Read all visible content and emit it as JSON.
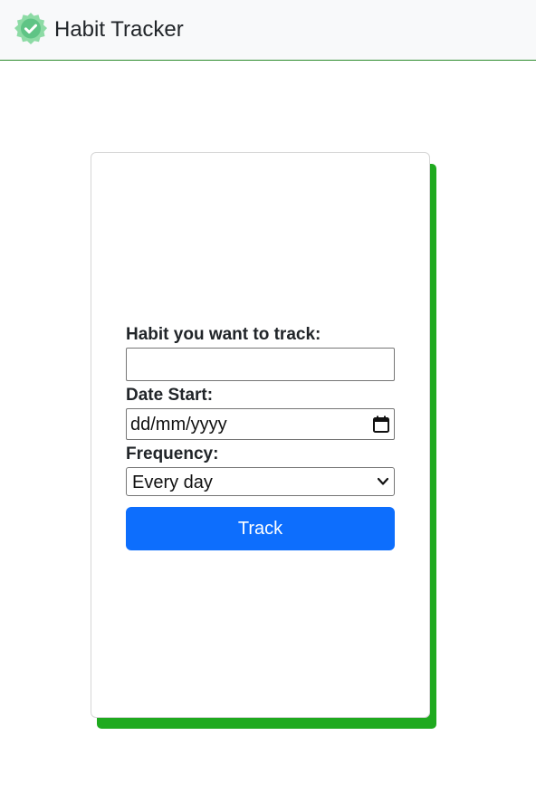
{
  "navbar": {
    "brand_title": "Habit Tracker",
    "logo_icon": "check-badge-icon",
    "logo_color": "#7fd49a",
    "border_color": "#2e8b2e"
  },
  "form": {
    "habit_label": "Habit you want to track:",
    "habit_value": "",
    "date_label": "Date Start:",
    "date_placeholder": "dd/mm/yyyy",
    "date_icon": "calendar-icon",
    "frequency_label": "Frequency:",
    "frequency_selected": "Every day",
    "frequency_icon": "chevron-down-icon",
    "submit_label": "Track"
  },
  "colors": {
    "accent": "#0d6efd",
    "card_shadow": "#1faa1f",
    "navbar_bg": "#f8f9fa"
  }
}
